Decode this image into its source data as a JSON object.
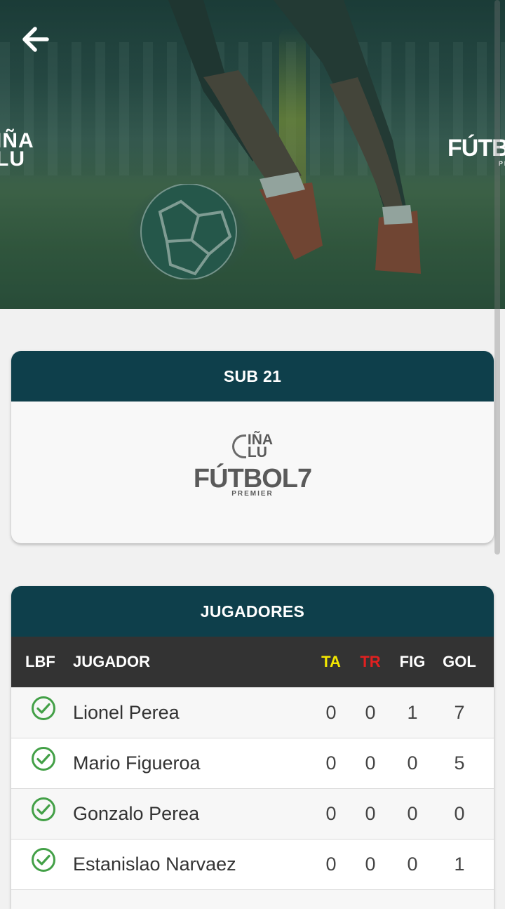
{
  "hero": {
    "logo_left": "IÑA\nLU",
    "logo_right_main": "FÚTBOL",
    "logo_right_sub": "PREMIER"
  },
  "category": {
    "title": "SUB 21",
    "logo_top_line1": "IÑA",
    "logo_top_line2": "LU",
    "logo_main": "FÚTBOL7",
    "logo_sub": "PREMIER"
  },
  "players": {
    "title": "JUGADORES",
    "columns": {
      "lbf": "LBF",
      "name": "JUGADOR",
      "ta": "TA",
      "tr": "TR",
      "fig": "FIG",
      "gol": "GOL"
    },
    "colors": {
      "ta": "#f2e600",
      "tr": "#e02020",
      "header_bg": "#0e3f4b",
      "check": "#43a047"
    },
    "rows": [
      {
        "name": "Lionel Perea",
        "ta": "0",
        "tr": "0",
        "fig": "1",
        "gol": "7"
      },
      {
        "name": "Mario Figueroa",
        "ta": "0",
        "tr": "0",
        "fig": "0",
        "gol": "5"
      },
      {
        "name": "Gonzalo Perea",
        "ta": "0",
        "tr": "0",
        "fig": "0",
        "gol": "0"
      },
      {
        "name": "Estanislao Narvaez",
        "ta": "0",
        "tr": "0",
        "fig": "0",
        "gol": "1"
      }
    ]
  }
}
